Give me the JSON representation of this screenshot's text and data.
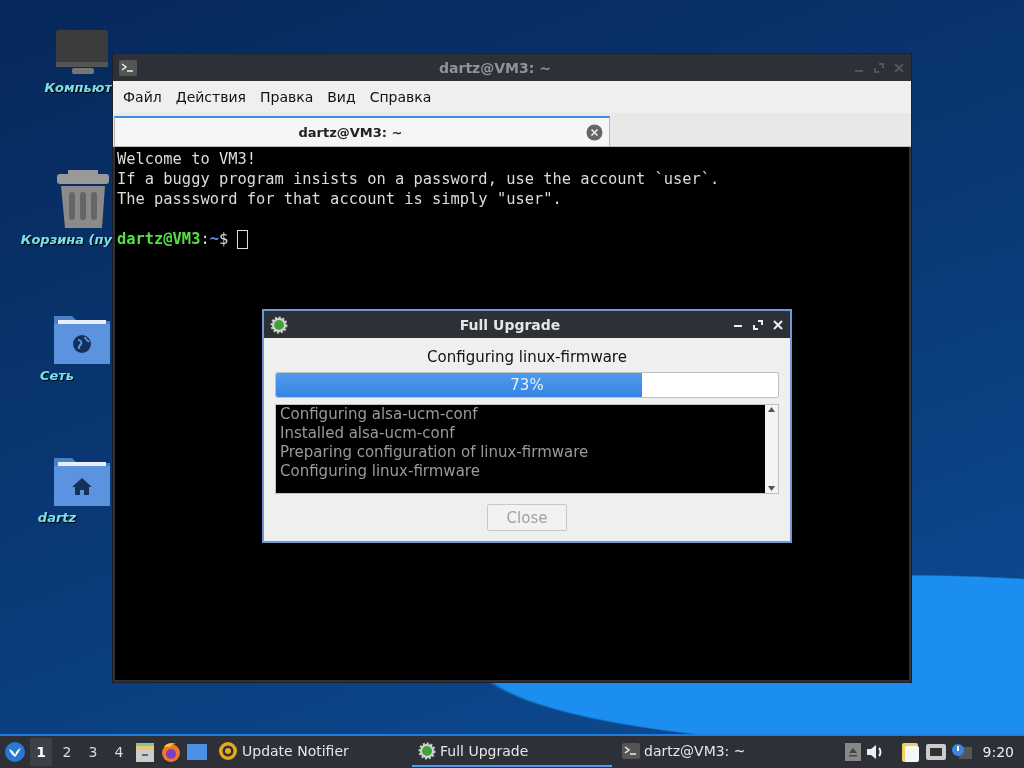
{
  "desktop_icons": [
    {
      "kind": "computer",
      "label": "Компьют"
    },
    {
      "kind": "trash",
      "label": "Корзина (пу"
    },
    {
      "kind": "network",
      "label": "Сеть"
    },
    {
      "kind": "home",
      "label": "dartz"
    }
  ],
  "terminal": {
    "title": "dartz@VM3: ~",
    "menu": [
      "Файл",
      "Действия",
      "Правка",
      "Вид",
      "Справка"
    ],
    "tabs": [
      {
        "label": "dartz@VM3: ~",
        "selected": true
      }
    ],
    "lines": [
      "Welcome to VM3!",
      "If a buggy program insists on a password, use the account `user`.",
      "The passsword for that account is simply \"user\"."
    ],
    "prompt": {
      "user_host": "dartz@VM3",
      "separator": ":",
      "path": "~",
      "symbol": "$"
    }
  },
  "dialog": {
    "title": "Full Upgrade",
    "status": "Configuring linux-firmware",
    "progress": {
      "level": 0.73,
      "label": "73%"
    },
    "log": [
      "Configuring alsa-ucm-conf",
      "Installed alsa-ucm-conf",
      "Preparing configuration of linux-firmware",
      "Configuring linux-firmware"
    ],
    "button": {
      "label": "Close",
      "disabled": true
    }
  },
  "taskbar": {
    "workspaces": [
      {
        "label": "1",
        "selected": true
      },
      {
        "label": "2",
        "selected": false
      },
      {
        "label": "3",
        "selected": false
      },
      {
        "label": "4",
        "selected": false
      }
    ],
    "tasks": [
      {
        "kind": "notifier",
        "label": "Update Notifier",
        "selected": false
      },
      {
        "kind": "upgrade",
        "label": "Full Upgrade",
        "selected": true
      },
      {
        "kind": "terminal",
        "label": "dartz@VM3: ~",
        "selected": false
      }
    ],
    "clock": "9:20"
  }
}
